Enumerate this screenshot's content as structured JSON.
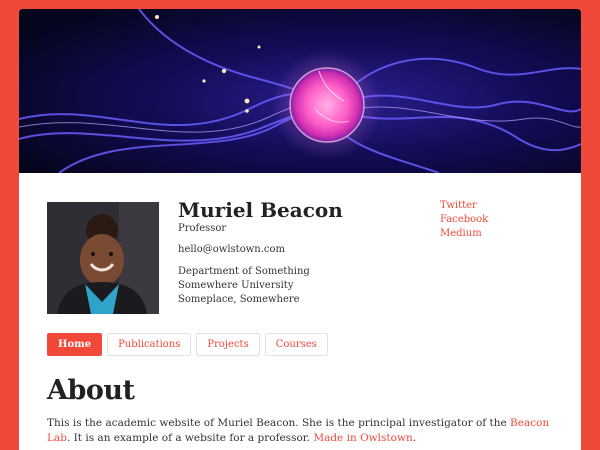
{
  "profile": {
    "name": "Muriel Beacon",
    "role": "Professor",
    "email": "hello@owlstown.com",
    "address": [
      "Department of Something",
      "Somewhere University",
      "Someplace, Somewhere"
    ]
  },
  "social": {
    "links": [
      "Twitter",
      "Facebook",
      "Medium"
    ]
  },
  "nav": {
    "tabs": [
      "Home",
      "Publications",
      "Projects",
      "Courses"
    ],
    "active": "Home"
  },
  "about": {
    "heading": "About",
    "text_1": "This is the academic website of Muriel Beacon. She is the principal investigator of the ",
    "link_1": "Beacon Lab",
    "text_2": ". It is an example of a website for a professor. ",
    "link_2": "Made in Owlstown",
    "text_3": "."
  },
  "colors": {
    "accent": "#f0493a",
    "background": "#f0493a",
    "card": "#ffffff",
    "banner": "#0a0a2e"
  },
  "icons": {
    "banner": "plasma-ball-image",
    "photo": "profile-photo"
  }
}
